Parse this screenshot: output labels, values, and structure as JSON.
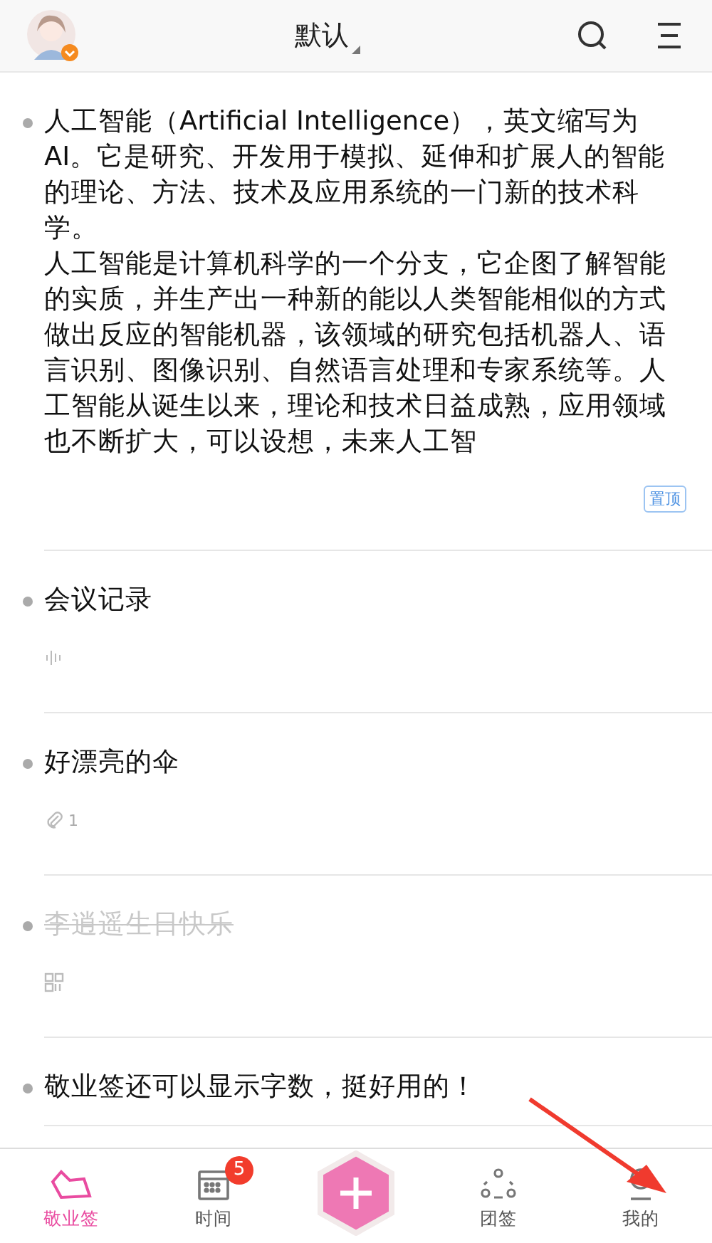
{
  "header": {
    "title": "默认"
  },
  "notes": [
    {
      "paragraphs": [
        "人工智能（Artificial Intelligence），英文缩写为AI。它是研究、开发用于模拟、延伸和扩展人的智能的理论、方法、技术及应用系统的一门新的技术科学。",
        "人工智能是计算机科学的一个分支，它企图了解智能的实质，并生产出一种新的能以人类智能相似的方式做出反应的智能机器，该领域的研究包括机器人、语言识别、图像识别、自然语言处理和专家系统等。人工智能从诞生以来，理论和技术日益成熟，应用领域也不断扩大，可以设想，未来人工智"
      ],
      "done": false,
      "tag": "置顶"
    },
    {
      "paragraphs": [
        "会议记录"
      ],
      "done": false,
      "attachment": {
        "kind": "voice"
      }
    },
    {
      "paragraphs": [
        "好漂亮的伞"
      ],
      "done": false,
      "attachment": {
        "kind": "file",
        "count": "1"
      }
    },
    {
      "paragraphs": [
        "李逍遥生日快乐"
      ],
      "done": true,
      "attachment": {
        "kind": "grid"
      }
    },
    {
      "paragraphs": [
        "敬业签还可以显示字数，挺好用的！"
      ],
      "done": false
    }
  ],
  "tabs": [
    {
      "kind": "notes",
      "label": "敬业签",
      "selected": true
    },
    {
      "kind": "calendar",
      "label": "时间",
      "selected": false,
      "badge": "5"
    },
    {
      "kind": "add"
    },
    {
      "kind": "team",
      "label": "团签",
      "selected": false
    },
    {
      "kind": "profile",
      "label": "我的",
      "selected": false
    }
  ]
}
